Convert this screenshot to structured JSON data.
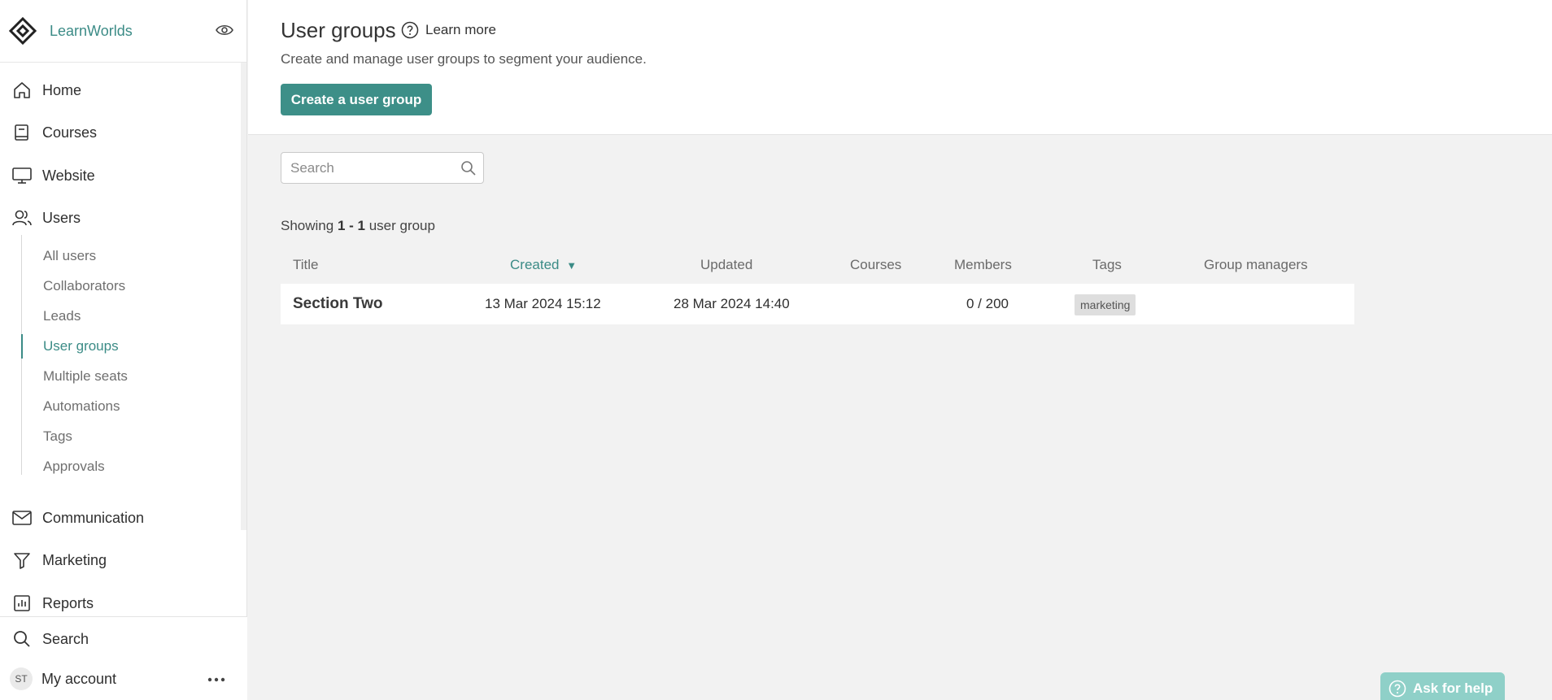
{
  "brand": {
    "name": "LearnWorlds"
  },
  "nav": {
    "home": "Home",
    "courses": "Courses",
    "website": "Website",
    "users": "Users",
    "communication": "Communication",
    "marketing": "Marketing",
    "reports": "Reports",
    "search": "Search",
    "my_account": "My account",
    "avatar_initials": "ST"
  },
  "subnav": {
    "items": [
      "All users",
      "Collaborators",
      "Leads",
      "User groups",
      "Multiple seats",
      "Automations",
      "Tags",
      "Approvals"
    ],
    "active": "User groups"
  },
  "header": {
    "title": "User groups",
    "learn_more": "Learn more",
    "subtitle": "Create and manage user groups to segment your audience.",
    "create_button": "Create a user group"
  },
  "search": {
    "placeholder": "Search"
  },
  "showing": {
    "prefix": "Showing ",
    "range": "1 - 1",
    "suffix": " user group"
  },
  "table": {
    "columns": [
      "Title",
      "Created",
      "Updated",
      "Courses",
      "Members",
      "Tags",
      "Group managers"
    ],
    "sorted_column": "Created",
    "sort_indicator": "▼",
    "rows": [
      {
        "title": "Section Two",
        "created": "13 Mar 2024 15:12",
        "updated": "28 Mar 2024 14:40",
        "courses": "",
        "members": "0 / 200",
        "tags": [
          "marketing"
        ],
        "group_managers": ""
      }
    ]
  },
  "help": {
    "label": "Ask for help"
  },
  "colors": {
    "accent": "#3d8f88",
    "accent_text": "#3b8b86",
    "help_bg": "#8fd0c8"
  }
}
